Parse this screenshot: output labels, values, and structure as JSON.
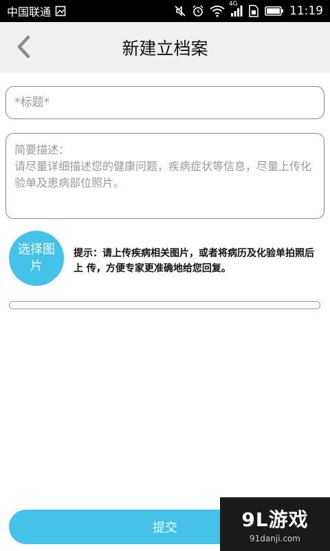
{
  "status_bar": {
    "carrier": "中国联通",
    "network": "4G",
    "time": "11:19",
    "icons": [
      "image-icon",
      "mute-icon",
      "alarm-icon",
      "wifi-icon",
      "signal-icon",
      "sim-icon",
      "battery-icon"
    ]
  },
  "header": {
    "title": "新建立档案",
    "back_icon": "chevron-left-icon"
  },
  "form": {
    "title_placeholder": "*标题*",
    "desc_placeholder": "简要描述：\n请尽量详细描述您的健康问题，疾病症状等信息，尽量上传化验单及患病部位照片。"
  },
  "upload": {
    "button_label": "选择图片",
    "tip": "提示：请上传疾病相关图片，或者将病历及化验单拍照后上 传，方便专家更准确地给您回复。",
    "progress_percent": 0
  },
  "submit_label": "提交",
  "watermark": {
    "main": "9L游戏",
    "sub": "91danji.com"
  },
  "colors": {
    "accent": "#45c2ea",
    "status_bar": "#000000",
    "header_bg": "#f0f0f0"
  }
}
